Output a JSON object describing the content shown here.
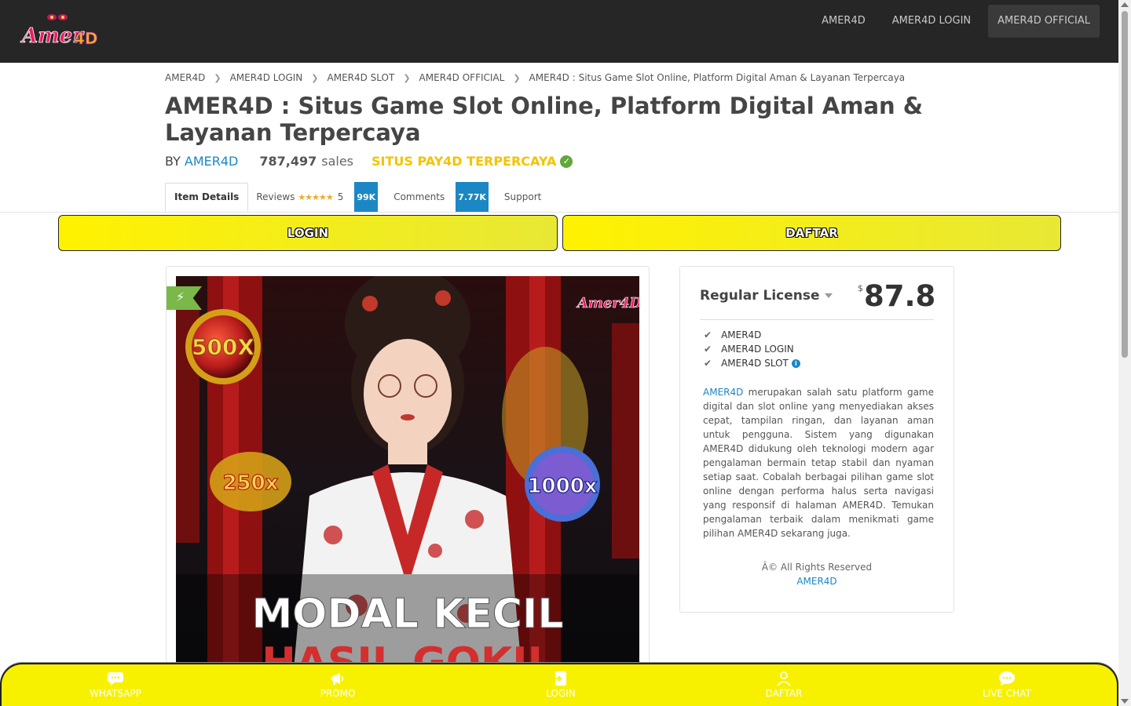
{
  "header": {
    "logo_text": "Amer4D",
    "nav": [
      "AMER4D",
      "AMER4D LOGIN",
      "AMER4D OFFICIAL"
    ]
  },
  "breadcrumb": [
    "AMER4D",
    "AMER4D LOGIN",
    "AMER4D SLOT",
    "AMER4D OFFICIAL",
    "AMER4D : Situs Game Slot Online, Platform Digital Aman & Layanan Terpercaya"
  ],
  "title": "AMER4D : Situs Game Slot Online, Platform Digital Aman & Layanan Terpercaya",
  "byline": {
    "by": "BY",
    "author": "AMER4D",
    "sales_count": "787,497",
    "sales_label": "sales",
    "trusted": "SITUS PAY4D TERPERCAYA"
  },
  "tabs": {
    "item_details": "Item Details",
    "reviews": "Reviews",
    "reviews_stars": "★★★★★",
    "reviews_score": "5",
    "reviews_badge": "99K",
    "comments": "Comments",
    "comments_badge": "7.77K",
    "support": "Support"
  },
  "buttons": {
    "login": "LOGIN",
    "daftar": "DAFTAR"
  },
  "preview": {
    "badge_500": "500X",
    "badge_250": "250x",
    "badge_1000": "1000x",
    "headline": "MODAL KECIL",
    "subline": "HASIL GOKIL"
  },
  "license": {
    "title": "Regular License",
    "currency": "$",
    "price": "87.8",
    "features": [
      "AMER4D",
      "AMER4D LOGIN",
      "AMER4D SLOT"
    ],
    "desc_link": "AMER4D",
    "description": " merupakan salah satu platform game digital dan slot online yang menyediakan akses cepat, tampilan ringan, dan layanan aman untuk pengguna. Sistem yang digunakan AMER4D didukung oleh teknologi modern agar pengalaman bermain tetap stabil dan nyaman setiap saat. Cobalah berbagai pilihan game slot online dengan performa halus serta navigasi yang responsif di halaman AMER4D. Temukan pengalaman terbaik dalam menikmati game pilihan AMER4D sekarang juga.",
    "rights": "Â© All Rights Reserved",
    "rights_brand": "AMER4D"
  },
  "bottom_nav": [
    "WHATSAPP",
    "PROMO",
    "LOGIN",
    "DAFTAR",
    "LIVE CHAT"
  ],
  "colors": {
    "topbar": "#262626",
    "accent_yellow": "#fff200",
    "link_blue": "#1b87c4",
    "trusted_yellow": "#f4c300",
    "check_green": "#61a83a"
  }
}
